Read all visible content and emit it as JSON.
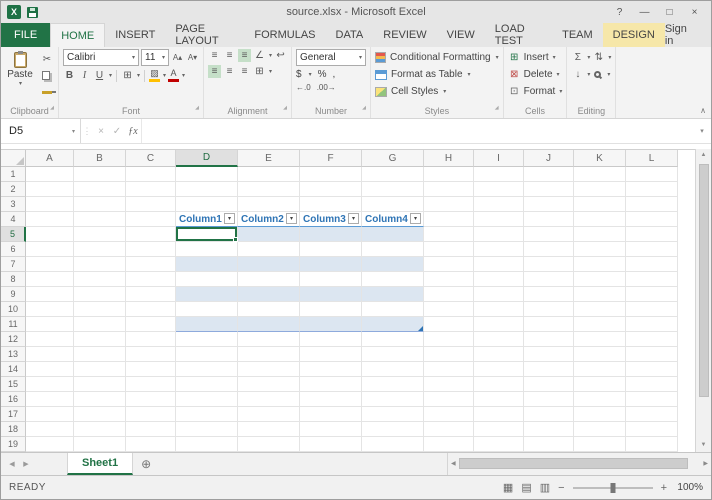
{
  "window": {
    "title": "source.xlsx - Microsoft Excel",
    "controls": {
      "help": "?",
      "minimize": "—",
      "maximize": "□",
      "close": "×"
    }
  },
  "ribbon": {
    "tabs": [
      {
        "label": "FILE",
        "style": "file"
      },
      {
        "label": "HOME",
        "style": "active"
      },
      {
        "label": "INSERT",
        "style": ""
      },
      {
        "label": "PAGE LAYOUT",
        "style": ""
      },
      {
        "label": "FORMULAS",
        "style": ""
      },
      {
        "label": "DATA",
        "style": ""
      },
      {
        "label": "REVIEW",
        "style": ""
      },
      {
        "label": "VIEW",
        "style": ""
      },
      {
        "label": "LOAD TEST",
        "style": ""
      },
      {
        "label": "TEAM",
        "style": ""
      },
      {
        "label": "DESIGN",
        "style": "contextual"
      }
    ],
    "sign_in": "Sign in",
    "groups": [
      "Clipboard",
      "Font",
      "Alignment",
      "Number",
      "Styles",
      "Cells",
      "Editing"
    ],
    "clipboard": {
      "paste": "Paste"
    },
    "font": {
      "name": "Calibri",
      "size": "11",
      "bold": "B",
      "italic": "I",
      "underline": "U"
    },
    "number": {
      "format": "General",
      "currency": "$",
      "percent": "%",
      "comma": ","
    },
    "styles": {
      "conditional": "Conditional Formatting",
      "format_table": "Format as Table",
      "cell_styles": "Cell Styles"
    },
    "cells": {
      "insert": "Insert",
      "delete": "Delete",
      "format": "Format"
    },
    "editing": {
      "autosum": "Σ"
    }
  },
  "icons": {
    "dropdown": "▾",
    "cut": "✂",
    "borders": "⊞",
    "fill_color": "▨",
    "font_color": "A",
    "increase_font": "A▴",
    "decrease_font": "A▾",
    "align": "≡",
    "orientation": "∠",
    "wrap_text": "↩",
    "merge_center": "⊞",
    "increase_decimal": "←.0",
    "decrease_decimal": ".00→",
    "fill": "↓",
    "sort_filter": "⇅",
    "insert_cells": "⊞",
    "delete_cells": "⊠",
    "format_cells": "⊡",
    "cancel": "×",
    "enter": "✓",
    "fx": "ƒx",
    "separator_dots": "⋮",
    "expand_formula": "▾",
    "collapse_ribbon": "∧",
    "dialog_launcher": "◢",
    "nav_left": "◀",
    "nav_right": "▶",
    "scroll_up": "▲",
    "scroll_down": "▼",
    "scroll_left": "◀",
    "scroll_right": "▶",
    "add_sheet": "⊕",
    "view_normal": "▦",
    "view_page_layout": "▤",
    "view_page_break": "▥",
    "zoom_out": "−",
    "zoom_in": "+"
  },
  "formula_bar": {
    "name_box": "D5",
    "formula": ""
  },
  "grid": {
    "columns": [
      "A",
      "B",
      "C",
      "D",
      "E",
      "F",
      "G",
      "H",
      "I",
      "J",
      "K",
      "L"
    ],
    "rows": [
      "1",
      "2",
      "3",
      "4",
      "5",
      "6",
      "7",
      "8",
      "9",
      "10",
      "11",
      "12",
      "13",
      "14",
      "15",
      "16",
      "17",
      "18",
      "19"
    ],
    "selection": {
      "cell": "D5",
      "column": "D",
      "row": "5"
    },
    "table": {
      "headers": [
        "Column1",
        "Column2",
        "Column3",
        "Column4"
      ],
      "first_col_index": 3,
      "header_row": 4,
      "data_row_start": 5,
      "data_row_end": 11
    }
  },
  "sheet_bar": {
    "tabs": [
      "Sheet1"
    ]
  },
  "status_bar": {
    "mode": "READY",
    "zoom": "100%"
  }
}
